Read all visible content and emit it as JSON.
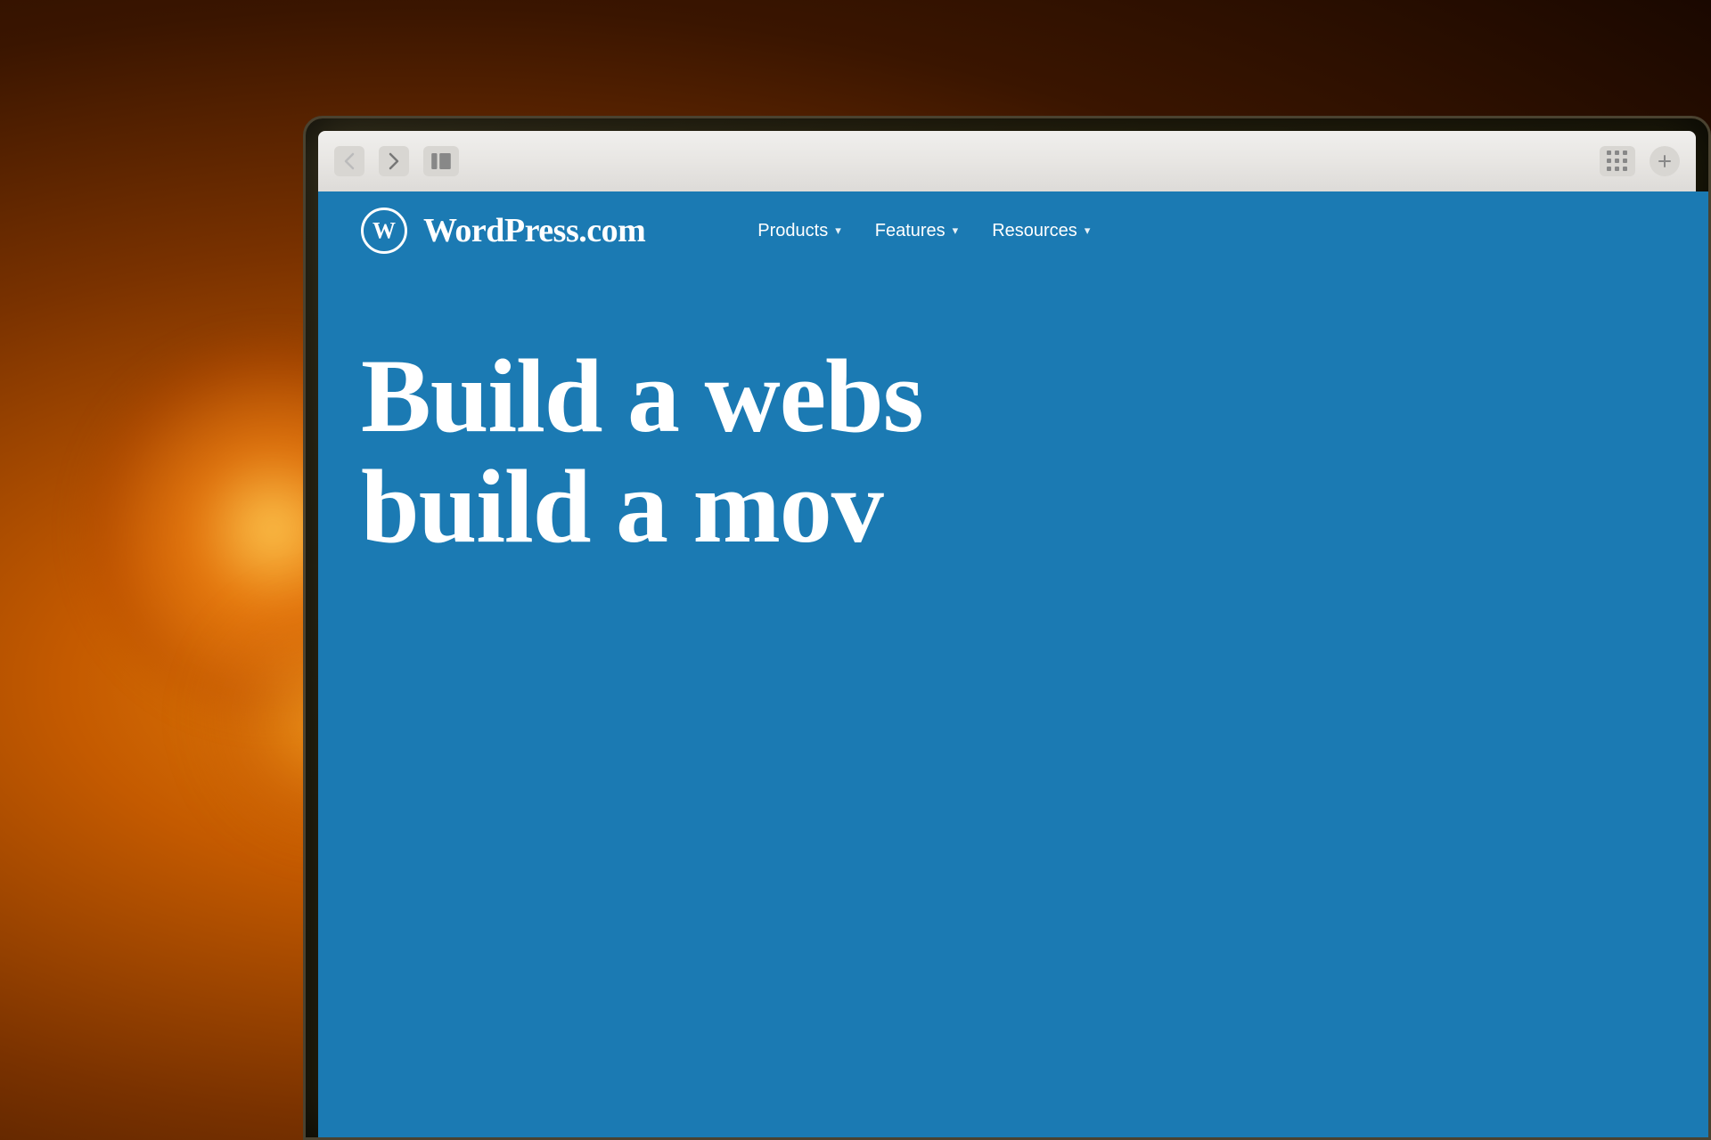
{
  "background": {
    "description": "Warm bokeh orange background of a physical space"
  },
  "browser": {
    "nav": {
      "back_label": "‹",
      "forward_label": "›",
      "back_disabled": true,
      "forward_disabled": false
    }
  },
  "wordpress": {
    "logo_text": "WordPress.com",
    "logo_symbol": "W",
    "nav": {
      "products_label": "Products",
      "features_label": "Features",
      "resources_label": "Resources"
    },
    "hero": {
      "line1": "Build a webs",
      "line2": "build a mov"
    }
  }
}
